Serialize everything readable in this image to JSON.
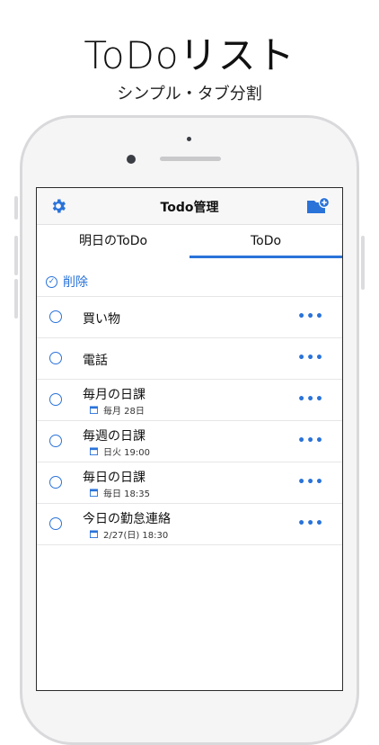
{
  "promo": {
    "title": "ToDoリスト",
    "subtitle": "シンプル・タブ分割"
  },
  "app": {
    "nav_title": "Todo管理",
    "accent": "#2a73d9",
    "icons": {
      "left": "gear-icon",
      "right": "folder-add-icon"
    }
  },
  "tabs": [
    {
      "label": "明日のToDo",
      "selected": false
    },
    {
      "label": "ToDo",
      "selected": true
    }
  ],
  "delete_label": "削除",
  "items": [
    {
      "title": "買い物"
    },
    {
      "title": "電話"
    },
    {
      "title": "毎月の日課",
      "schedule": "毎月 28日"
    },
    {
      "title": "毎週の日課",
      "schedule": "日火 19:00"
    },
    {
      "title": "毎日の日課",
      "schedule": "毎日 18:35"
    },
    {
      "title": "今日の勤怠連絡",
      "schedule": "2/27(日) 18:30"
    }
  ],
  "more_glyph": "•••"
}
